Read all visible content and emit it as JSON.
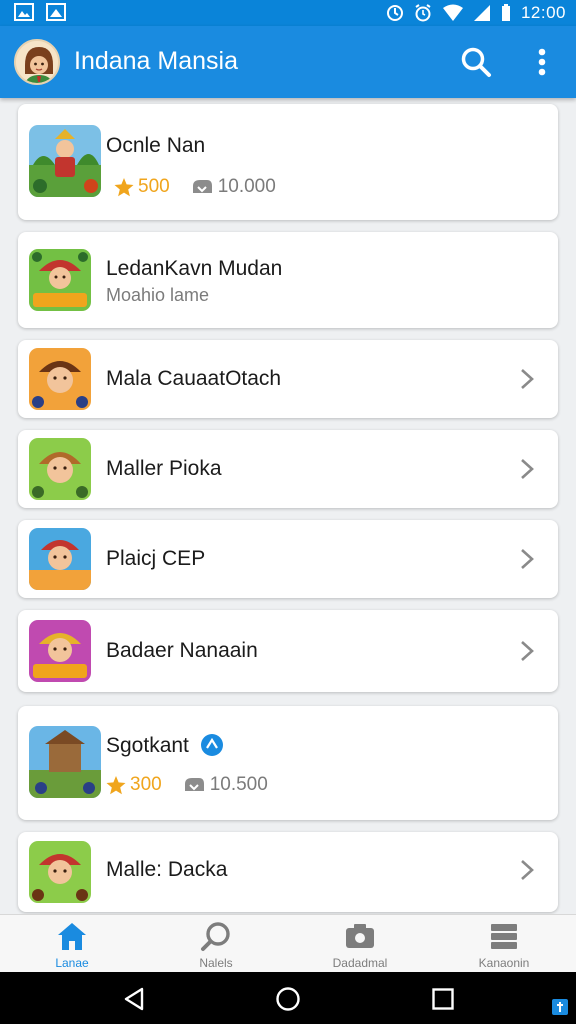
{
  "status_bar": {
    "time": "12:00"
  },
  "app_bar": {
    "title": "Indana Mansia",
    "icons": [
      "avatar",
      "search-icon",
      "more-vert-icon"
    ]
  },
  "list": [
    {
      "title": "Ocnle Nan",
      "rating": "500",
      "downloads": "10.000"
    },
    {
      "title": "LedanKavn Mudan",
      "subtitle": "Moahio lame"
    },
    {
      "title": "Mala CauaatOtach"
    },
    {
      "title": "Maller Pioka"
    },
    {
      "title": "Plaicj CEP"
    },
    {
      "title": "Badaer Nanaain"
    },
    {
      "title": "Sgotkant",
      "rating": "300",
      "downloads": "10.500",
      "verified_icon": "verified-icon"
    },
    {
      "title": "Malle: Dacka"
    }
  ],
  "bottom_nav": [
    {
      "label": "Lanae",
      "icon": "home-icon",
      "active": true
    },
    {
      "label": "Nalels",
      "icon": "search-icon"
    },
    {
      "label": "Dadadmal",
      "icon": "camera-icon"
    },
    {
      "label": "Kanaonin",
      "icon": "library-icon"
    }
  ],
  "colors": {
    "primary": "#1a8be0",
    "status_bar": "#0a84d9",
    "star": "#f0a51d",
    "background": "#eef0f2"
  }
}
